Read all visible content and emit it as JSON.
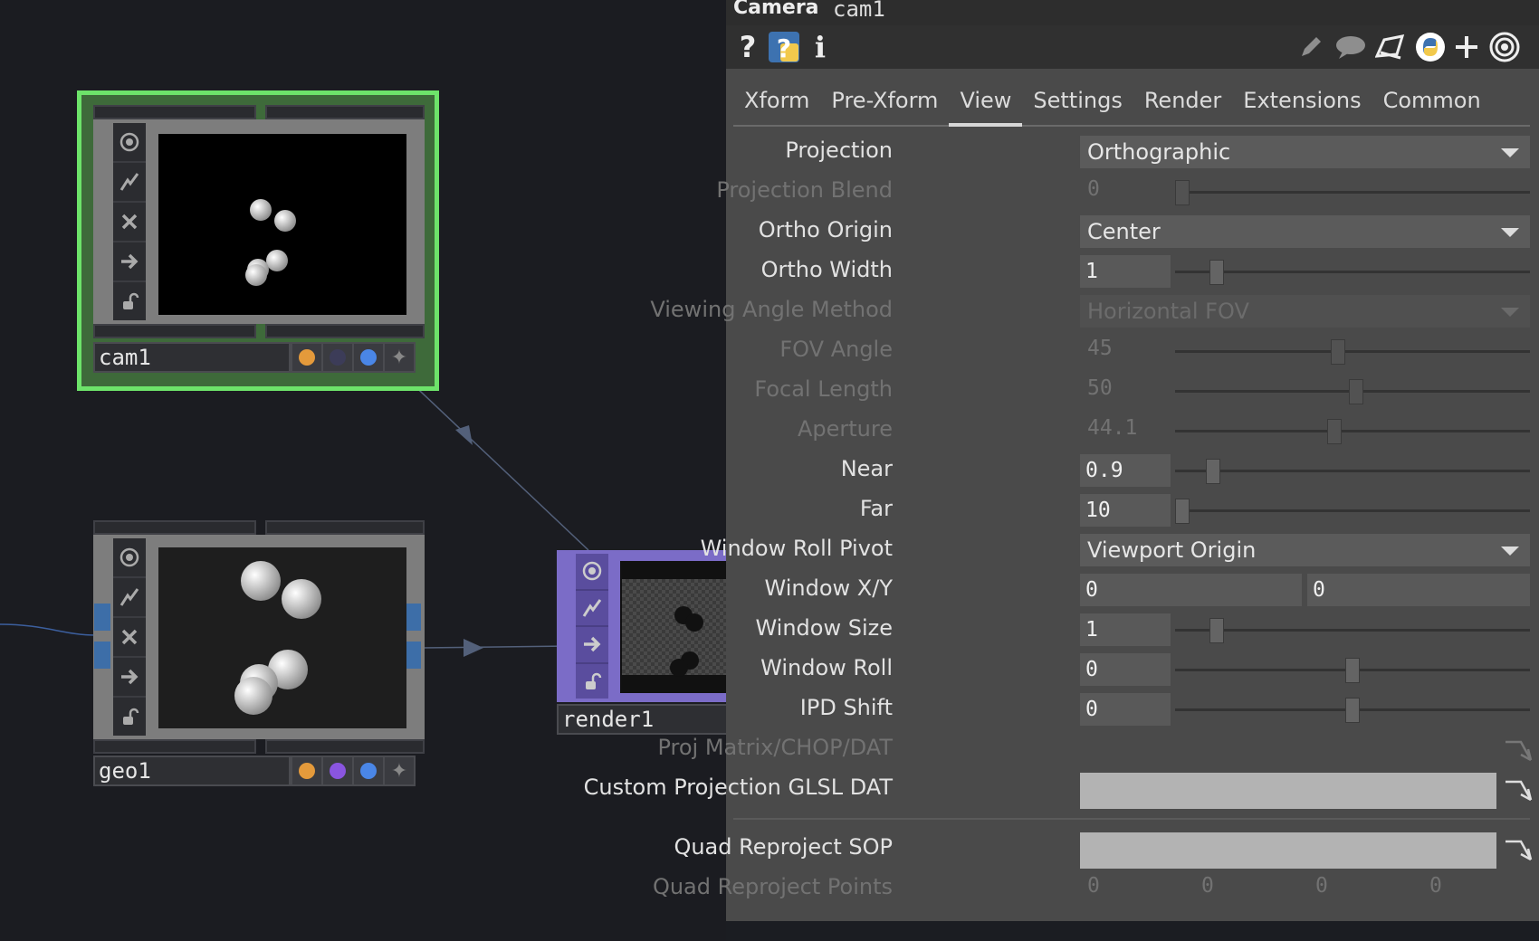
{
  "network": {
    "nodes": [
      {
        "id": "cam1",
        "name": "cam1",
        "selected": true,
        "flags": [
          "#e49a3b",
          "#3c3c58",
          "#4a86e6"
        ]
      },
      {
        "id": "geo1",
        "name": "geo1",
        "selected": false,
        "flags": [
          "#e49a3b",
          "#8a55e0",
          "#4a86e6"
        ]
      },
      {
        "id": "render1",
        "name": "render1",
        "selected": false
      }
    ]
  },
  "panel": {
    "type_label": "Camera",
    "op_name": "cam1",
    "toolbar_left": [
      "help-icon",
      "python-help-icon",
      "info-icon"
    ],
    "toolbar_right": [
      "edit-icon",
      "comment-icon",
      "clone-icon",
      "python-icon",
      "add-icon",
      "target-icon"
    ],
    "tabs": [
      "Xform",
      "Pre-Xform",
      "View",
      "Settings",
      "Render",
      "Extensions",
      "Common"
    ],
    "active_tab": "View",
    "params": {
      "projection": {
        "label": "Projection",
        "value": "Orthographic"
      },
      "projection_blend": {
        "label": "Projection Blend",
        "value": "0",
        "slider": 0.0
      },
      "ortho_origin": {
        "label": "Ortho Origin",
        "value": "Center"
      },
      "ortho_width": {
        "label": "Ortho Width",
        "value": "1",
        "slider": 0.1
      },
      "viewing_angle_method": {
        "label": "Viewing Angle Method",
        "value": "Horizontal FOV"
      },
      "fov_angle": {
        "label": "FOV Angle",
        "value": "45",
        "slider": 0.45
      },
      "focal_length": {
        "label": "Focal Length",
        "value": "50",
        "slider": 0.5
      },
      "aperture": {
        "label": "Aperture",
        "value": "44.1",
        "slider": 0.44
      },
      "near": {
        "label": "Near",
        "value": "0.9",
        "slider": 0.09
      },
      "far": {
        "label": "Far",
        "value": "10",
        "slider": 0.0
      },
      "window_roll_pivot": {
        "label": "Window Roll Pivot",
        "value": "Viewport Origin"
      },
      "window_xy": {
        "label": "Window X/Y",
        "x": "0",
        "y": "0"
      },
      "window_size": {
        "label": "Window Size",
        "value": "1",
        "slider": 0.1
      },
      "window_roll": {
        "label": "Window Roll",
        "value": "0",
        "slider": 0.5
      },
      "ipd_shift": {
        "label": "IPD Shift",
        "value": "0",
        "slider": 0.5
      },
      "proj_matrix": {
        "label": "Proj Matrix/CHOP/DAT"
      },
      "custom_proj_glsl": {
        "label": "Custom Projection GLSL DAT",
        "value": ""
      },
      "quad_reproject_sop": {
        "label": "Quad Reproject SOP",
        "value": ""
      },
      "quad_reproject_points": {
        "label": "Quad Reproject Points",
        "values": [
          "0",
          "0",
          "0",
          "0"
        ]
      }
    }
  }
}
